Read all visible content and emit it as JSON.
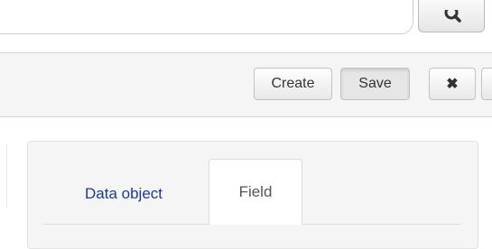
{
  "search": {
    "value": "",
    "placeholder": "",
    "button_icon": "search-icon"
  },
  "toolbar": {
    "create_label": "Create",
    "save_label": "Save",
    "close_icon": "close-icon",
    "close_label": "✖"
  },
  "tabs": [
    {
      "label": "Data object",
      "active": false
    },
    {
      "label": "Field",
      "active": true
    }
  ],
  "colors": {
    "tab_link": "#1f3a8a",
    "toolbar_bg": "#f5f5f5",
    "panel_bg": "#f5f5f5"
  }
}
